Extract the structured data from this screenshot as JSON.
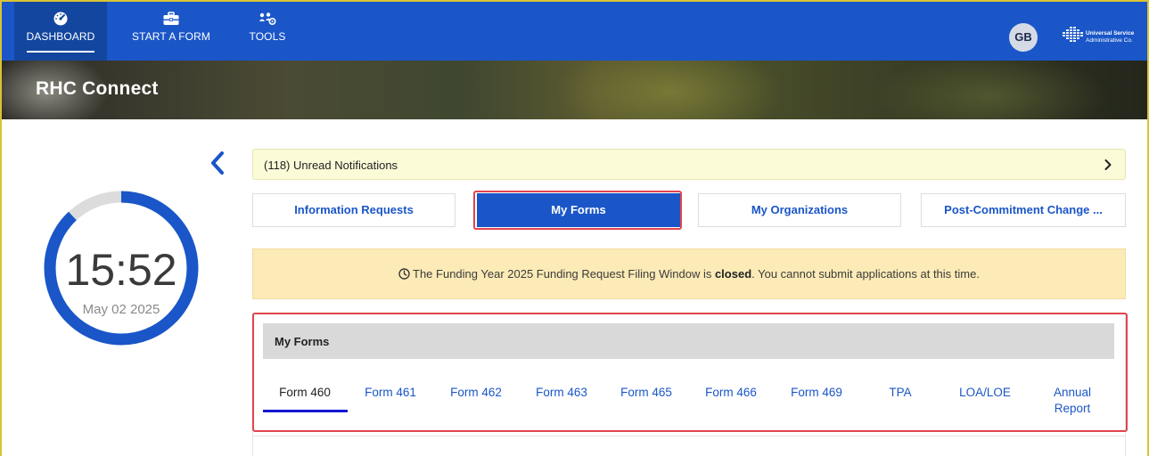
{
  "nav": {
    "items": [
      {
        "label": "DASHBOARD",
        "icon": "dashboard-gauge-icon"
      },
      {
        "label": "START A FORM",
        "icon": "briefcase-icon"
      },
      {
        "label": "TOOLS",
        "icon": "tools-people-icon"
      }
    ],
    "avatar_initials": "GB",
    "logo_line1": "Universal Service",
    "logo_line2": "Administrative Co."
  },
  "hero": {
    "title": "RHC Connect"
  },
  "clock": {
    "time": "15:52",
    "date": "May 02 2025",
    "progress_fraction": 0.88
  },
  "notifications": {
    "label": "(118) Unread Notifications"
  },
  "tabs": [
    {
      "label": "Information Requests",
      "active": false
    },
    {
      "label": "My Forms",
      "active": true
    },
    {
      "label": "My Organizations",
      "active": false
    },
    {
      "label": "Post-Commitment Change ...",
      "active": false
    }
  ],
  "banner": {
    "prefix": "The Funding Year 2025 Funding Request Filing Window is ",
    "emphasis": "closed",
    "suffix": ". You cannot submit applications at this time."
  },
  "my_forms": {
    "header": "My Forms",
    "tabs": [
      {
        "label": "Form 460",
        "active": true
      },
      {
        "label": "Form 461",
        "active": false
      },
      {
        "label": "Form 462",
        "active": false
      },
      {
        "label": "Form 463",
        "active": false
      },
      {
        "label": "Form 465",
        "active": false
      },
      {
        "label": "Form 466",
        "active": false
      },
      {
        "label": "Form 469",
        "active": false
      },
      {
        "label": "TPA",
        "active": false
      },
      {
        "label": "LOA/LOE",
        "active": false
      },
      {
        "label": "Annual",
        "label2": "Report",
        "active": false
      }
    ]
  },
  "colors": {
    "primary": "#1a56c8",
    "nav_active": "#13479f",
    "highlight": "#e0454d",
    "warning_bg": "#fcebb6",
    "notification_bg": "#fcfbd8"
  }
}
